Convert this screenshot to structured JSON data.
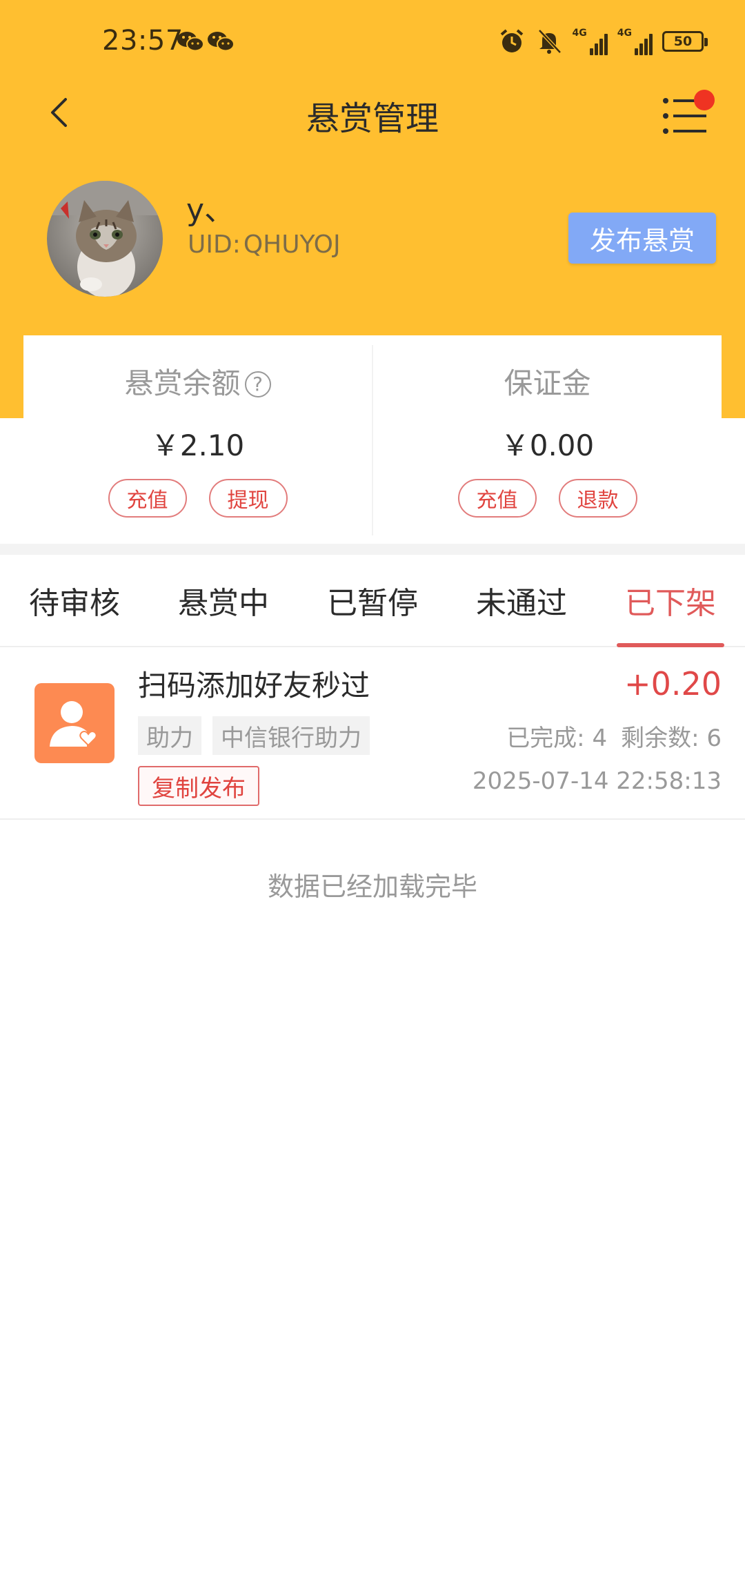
{
  "status_bar": {
    "time": "23:57",
    "signal_1_label": "4G",
    "signal_2_label": "4G",
    "battery": "50"
  },
  "header": {
    "title": "悬赏管理"
  },
  "profile": {
    "username": "y、",
    "uid_label": "UID:",
    "uid_value": "QHUYOJ",
    "publish_label": "发布悬赏"
  },
  "balance": {
    "reward_label": "悬赏余额",
    "help_symbol": "?",
    "reward_amount": "￥2.10",
    "reward_recharge": "充值",
    "reward_withdraw": "提现",
    "deposit_label": "保证金",
    "deposit_amount": "￥0.00",
    "deposit_recharge": "充值",
    "deposit_refund": "退款"
  },
  "tabs": [
    {
      "label": "待审核"
    },
    {
      "label": "悬赏中"
    },
    {
      "label": "已暂停"
    },
    {
      "label": "未通过"
    },
    {
      "label": "已下架"
    }
  ],
  "active_tab": "已下架",
  "tasks": [
    {
      "title": "扫码添加好友秒过",
      "reward": "+0.20",
      "tags": [
        "助力",
        "中信银行助力"
      ],
      "completed": "已完成: 4",
      "remaining": "剩余数: 6",
      "copy_label": "复制发布",
      "time": "2025-07-14 22:58:13"
    }
  ],
  "footer": {
    "load_done": "数据已经加载完毕"
  },
  "colors": {
    "header_bg": "#FFBF30",
    "accent_red": "#E05A5A",
    "publish_btn": "#82A9F6",
    "task_icon_bg": "#FD8A52"
  }
}
